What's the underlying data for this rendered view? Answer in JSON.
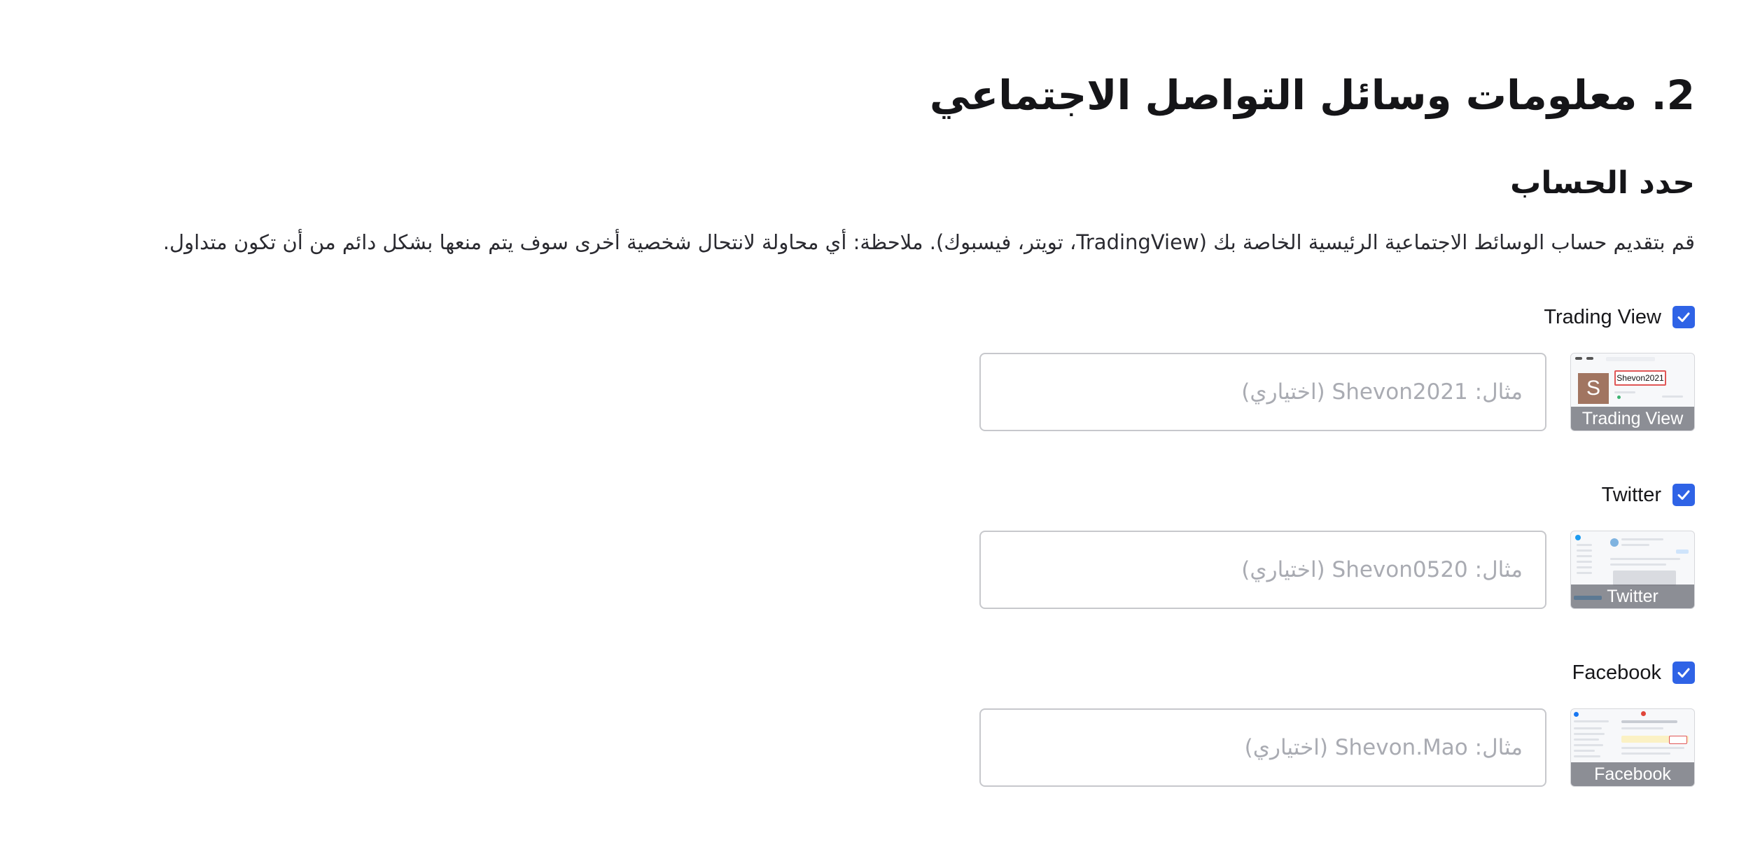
{
  "section": {
    "title": "2. معلومات وسائل التواصل الاجتماعي"
  },
  "subsection": {
    "title": "حدد الحساب",
    "description": "قم بتقديم حساب الوسائط الاجتماعية الرئيسية الخاصة بك (TradingView، تويتر، فيسبوك). ملاحظة: أي محاولة لانتحال شخصية أخرى سوف يتم منعها بشكل دائم من أن تكون متداول."
  },
  "platforms": [
    {
      "label": "Trading View",
      "checked": true,
      "thumbnail_caption": "Trading View",
      "thumbnail_avatar": "S",
      "thumbnail_name": "Shevon2021",
      "input_value": "",
      "input_placeholder": "مثال: Shevon2021 (اختياري)"
    },
    {
      "label": "Twitter",
      "checked": true,
      "thumbnail_caption": "Twitter",
      "input_value": "",
      "input_placeholder": "مثال: Shevon0520 (اختياري)"
    },
    {
      "label": "Facebook",
      "checked": true,
      "thumbnail_caption": "Facebook",
      "input_value": "",
      "input_placeholder": "مثال: Shevon.Mao (اختياري)"
    }
  ],
  "colors": {
    "checkbox": "#2f63e6",
    "input_border": "#c7c8cc",
    "placeholder": "#a9abb2"
  },
  "icons": {
    "checkbox": "checkmark-icon"
  }
}
